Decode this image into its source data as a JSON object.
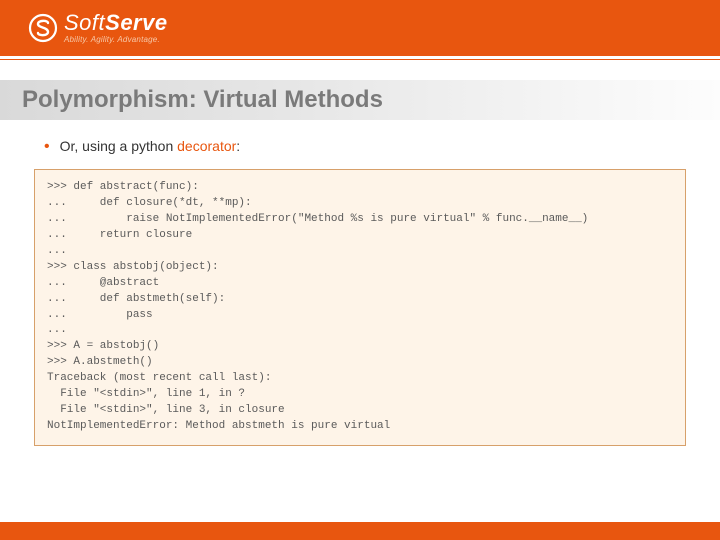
{
  "brand": {
    "name_prefix": "Soft",
    "name_suffix": "Serve",
    "tagline": "Ability. Agility. Advantage."
  },
  "title": "Polymorphism: Virtual Methods",
  "bullet": {
    "prefix": "Or, using a python ",
    "keyword": "decorator",
    "suffix": ":"
  },
  "code": ">>> def abstract(func):\n...     def closure(*dt, **mp):\n...         raise NotImplementedError(\"Method %s is pure virtual\" % func.__name__)\n...     return closure\n... \n>>> class abstobj(object):\n...     @abstract\n...     def abstmeth(self):\n...         pass\n... \n>>> A = abstobj()\n>>> A.abstmeth()\nTraceback (most recent call last):\n  File \"<stdin>\", line 1, in ?\n  File \"<stdin>\", line 3, in closure\nNotImplementedError: Method abstmeth is pure virtual"
}
